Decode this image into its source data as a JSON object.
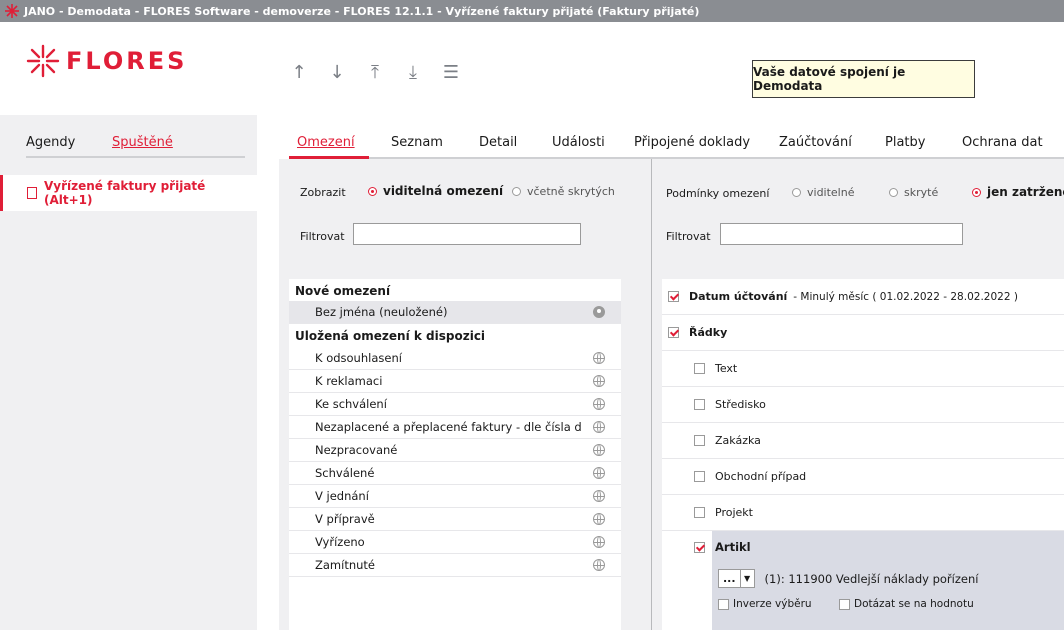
{
  "window": {
    "title": "JANO - Demodata - FLORES Software - demoverze - FLORES 12.1.1 - Vyřízené faktury přijaté  (Faktury přijaté)"
  },
  "logo": {
    "text": "FLORES"
  },
  "nav_arrows": [
    {
      "name": "arrow-up-icon",
      "glyph": "↑"
    },
    {
      "name": "arrow-down-icon",
      "glyph": "↓"
    },
    {
      "name": "arrow-top-icon",
      "glyph": "⤒"
    },
    {
      "name": "arrow-bottom-icon",
      "glyph": "⤓"
    },
    {
      "name": "menu-icon",
      "glyph": "☰"
    }
  ],
  "connection": {
    "text": "Vaše datové spojení je Demodata"
  },
  "left_tabs": {
    "agendy": "Agendy",
    "spustene": "Spuštěné"
  },
  "left_items": [
    {
      "label": "Vyřízené faktury přijaté (Alt+1)"
    }
  ],
  "main_tabs": [
    {
      "label": "Omezení",
      "active": true
    },
    {
      "label": "Seznam"
    },
    {
      "label": "Detail"
    },
    {
      "label": "Události"
    },
    {
      "label": "Připojené doklady"
    },
    {
      "label": "Zaúčtování"
    },
    {
      "label": "Platby"
    },
    {
      "label": "Ochrana dat"
    }
  ],
  "mid": {
    "zobrazit_label": "Zobrazit",
    "radio_visible": "viditelná omezení",
    "radio_hidden": "včetně skrytých",
    "filter_label": "Filtrovat",
    "filter_value": "",
    "list": {
      "new_header": "Nové omezení",
      "unsaved": "Bez jména (neuložené)",
      "saved_header": "Uložená omezení k dispozici",
      "items": [
        "K odsouhlasení",
        "K reklamaci",
        "Ke schválení",
        "Nezaplacené a přeplacené faktury - dle čísla d",
        "Nezpracované",
        "Schválené",
        "V jednání",
        "V přípravě",
        "Vyřízeno",
        "Zamítnuté"
      ]
    }
  },
  "right": {
    "conditions_label": "Podmínky omezení",
    "radio_visible": "viditelné",
    "radio_hidden": "skryté",
    "radio_checked": "jen zatržené",
    "filter_label": "Filtrovat",
    "filter_value": "",
    "conditions": {
      "datum_label": "Datum účtování",
      "datum_value": "- Minulý měsíc ( 01.02.2022 - 28.02.2022 )",
      "radky_label": "Řádky",
      "sub": [
        {
          "label": "Text",
          "checked": false
        },
        {
          "label": "Středisko",
          "checked": false
        },
        {
          "label": "Zakázka",
          "checked": false
        },
        {
          "label": "Obchodní případ",
          "checked": false
        },
        {
          "label": "Projekt",
          "checked": false
        }
      ],
      "artikl_label": "Artikl",
      "artikl_combo": "...",
      "artikl_value": "(1): 111900 Vedlejší náklady pořízení",
      "inverze_label": "Inverze výběru",
      "dotazat_label": "Dotázat se na hodnotu"
    }
  }
}
